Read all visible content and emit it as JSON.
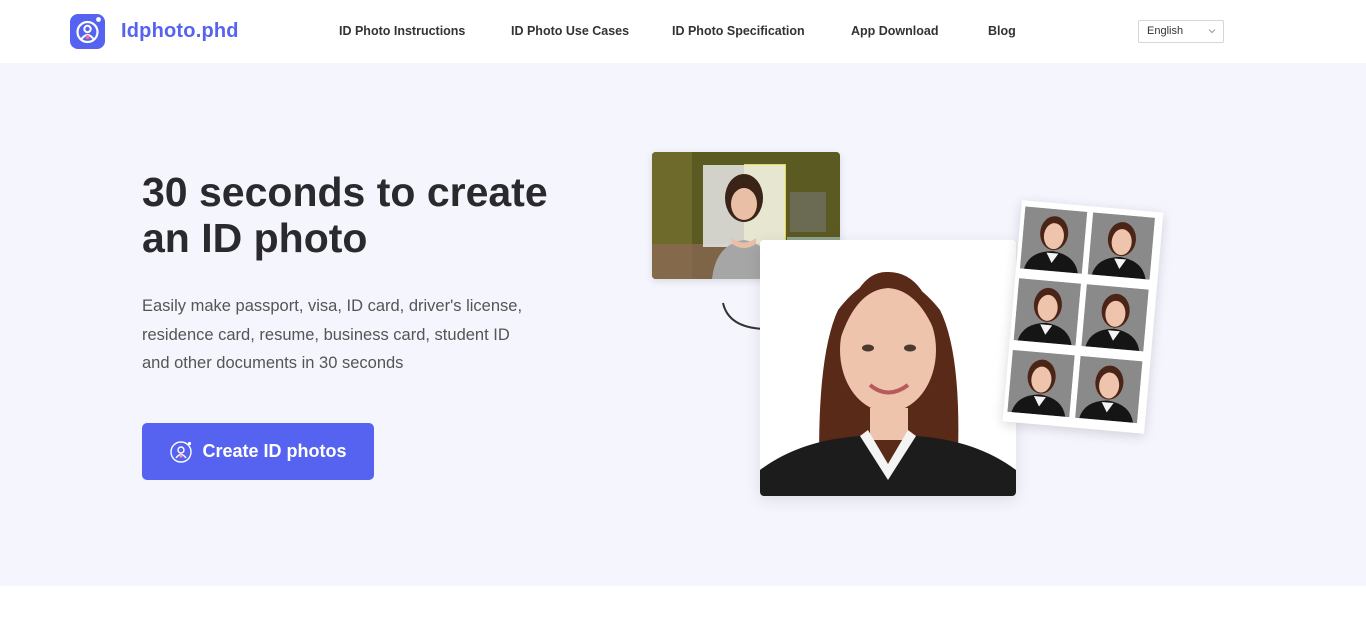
{
  "header": {
    "logo_text": "Idphoto.phd",
    "nav": [
      {
        "label": "ID Photo Instructions"
      },
      {
        "label": "ID Photo Use Cases"
      },
      {
        "label": "ID Photo Specification"
      },
      {
        "label": "App Download"
      },
      {
        "label": "Blog"
      }
    ],
    "language": {
      "selected": "English"
    }
  },
  "hero": {
    "title_lines": [
      "30 seconds to create",
      "an ID photo"
    ],
    "description_lines": [
      "Easily make passport, visa, ID card, driver's license,",
      "residence card, resume, business card, student ID",
      "and other documents in 30 seconds"
    ],
    "cta_label": "Create ID photos"
  },
  "colors": {
    "brand": "#5563f0",
    "hero_bg": "#f5f5fd",
    "title_text": "#2a2a2e",
    "body_text": "#555555"
  },
  "icons": {
    "logo": "person-badge-icon",
    "language_dropdown": "chevron-down-icon",
    "cta": "person-badge-icon",
    "flow": "curved-arrow-icon"
  }
}
